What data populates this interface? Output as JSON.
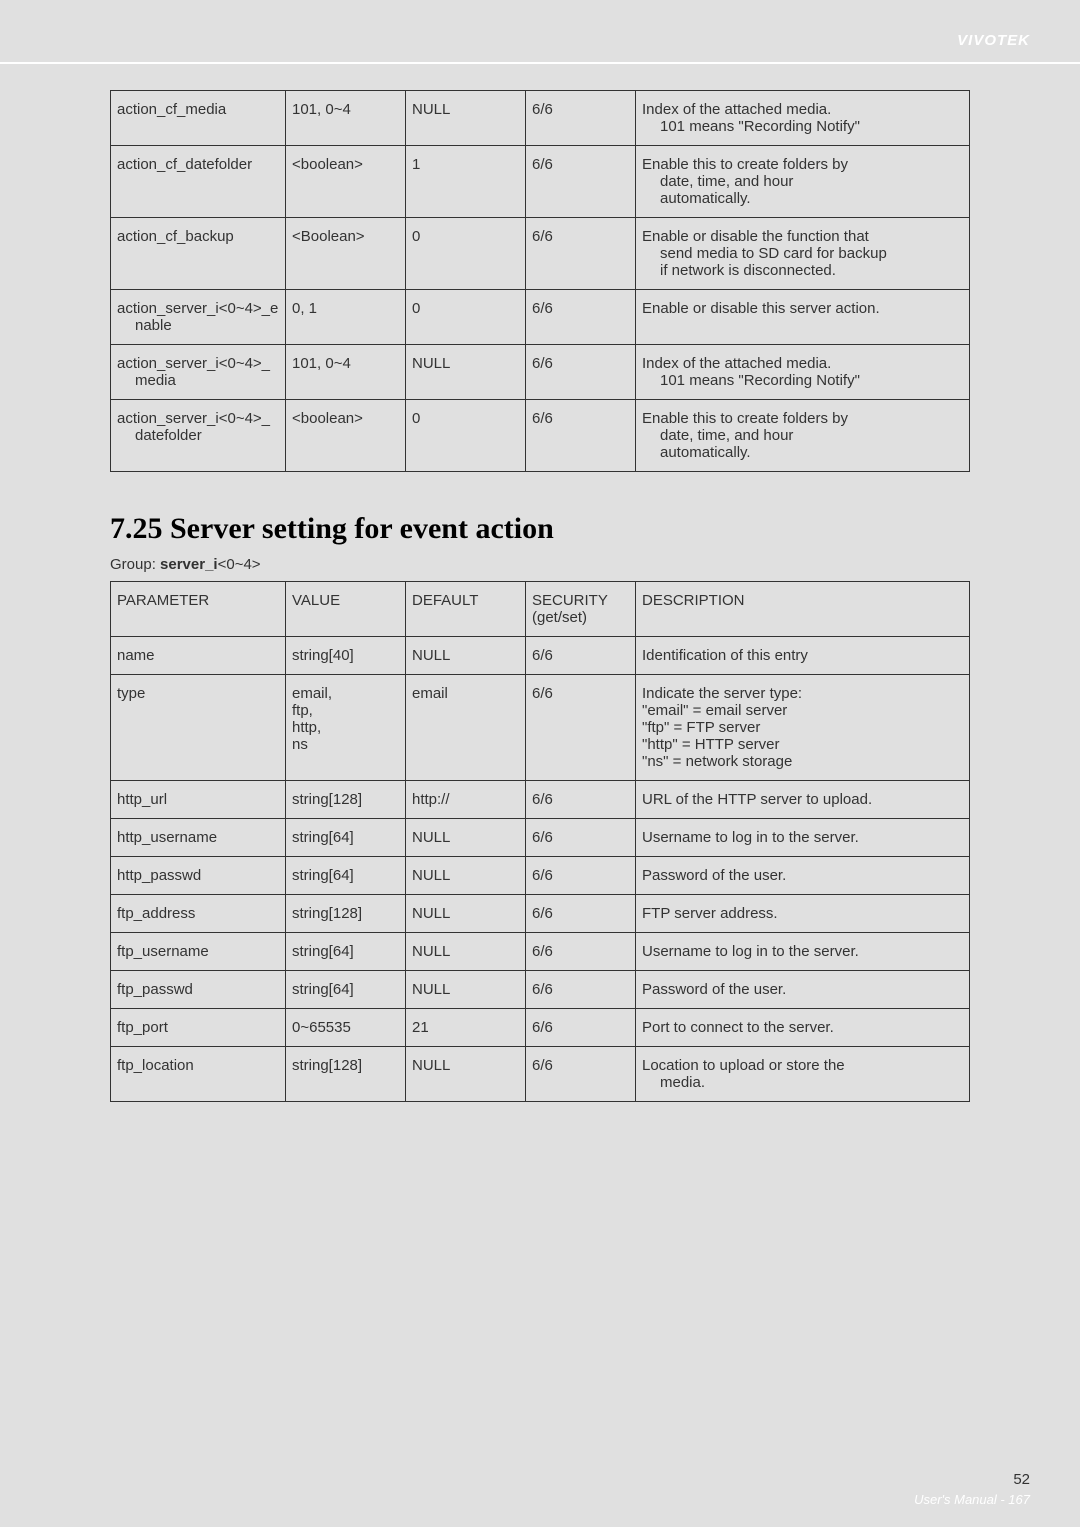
{
  "brand": "VIVOTEK",
  "table1": {
    "rows": [
      {
        "param": "action_cf_media",
        "value": "101, 0~4",
        "default": "NULL",
        "security": "6/6",
        "desc": "Index of the attached media.",
        "desc2": "101 means \"Recording Notify\""
      },
      {
        "param": "action_cf_datefolder",
        "value": "<boolean>",
        "default": "1",
        "security": "6/6",
        "desc": "Enable this to create folders by",
        "desc2": "date, time, and hour",
        "desc3": "automatically."
      },
      {
        "param": "action_cf_backup",
        "value": "<Boolean>",
        "default": "0",
        "security": "6/6",
        "desc": "Enable or disable the function that",
        "desc2": "send media to SD card for backup",
        "desc3": "if network is disconnected."
      },
      {
        "param": "action_server_i<0~4>_e",
        "param2": "nable",
        "value": "0, 1",
        "default": "0",
        "security": "6/6",
        "desc": "Enable or disable this server action."
      },
      {
        "param": "action_server_i<0~4>_",
        "param2": "media",
        "value": "101, 0~4",
        "default": "NULL",
        "security": "6/6",
        "desc": "Index of the attached media.",
        "desc2": "101 means \"Recording Notify\""
      },
      {
        "param": "action_server_i<0~4>_",
        "param2": "datefolder",
        "value": "<boolean>",
        "default": "0",
        "security": "6/6",
        "desc": "Enable this to create folders by",
        "desc2": "date, time, and hour",
        "desc3": "automatically."
      }
    ]
  },
  "section": {
    "title": "7.25 Server setting for event action",
    "group_prefix": "Group: ",
    "group_name": "server_i",
    "group_suffix": "<0~4>"
  },
  "table2": {
    "headers": {
      "param": "PARAMETER",
      "value": "VALUE",
      "default": "DEFAULT",
      "security": "SECURITY",
      "security2": "(get/set)",
      "desc": "DESCRIPTION"
    },
    "rows": [
      {
        "param": "name",
        "value": "string[40]",
        "default": "NULL",
        "security": "6/6",
        "desc": "Identification of this entry"
      },
      {
        "param": "type",
        "value": "email,",
        "value2": "ftp,",
        "value3": "http,",
        "value4": "ns",
        "default": "email",
        "security": "6/6",
        "desc": "Indicate the server type:",
        "desc2": "\"email\" = email server",
        "desc3": "\"ftp\" = FTP server",
        "desc4": "\"http\" = HTTP server",
        "desc5": "\"ns\" = network storage"
      },
      {
        "param": "http_url",
        "value": "string[128]",
        "default": "http://",
        "security": "6/6",
        "desc": "URL of the HTTP server to upload."
      },
      {
        "param": "http_username",
        "value": "string[64]",
        "default": "NULL",
        "security": "6/6",
        "desc": "Username to log in to the server."
      },
      {
        "param": "http_passwd",
        "value": "string[64]",
        "default": "NULL",
        "security": "6/6",
        "desc": "Password of the user."
      },
      {
        "param": "ftp_address",
        "value": "string[128]",
        "default": "NULL",
        "security": "6/6",
        "desc": "FTP server address."
      },
      {
        "param": "ftp_username",
        "value": "string[64]",
        "default": "NULL",
        "security": "6/6",
        "desc": "Username to log in to the server."
      },
      {
        "param": "ftp_passwd",
        "value": "string[64]",
        "default": "NULL",
        "security": "6/6",
        "desc": "Password of the user."
      },
      {
        "param": "ftp_port",
        "value": "0~65535",
        "default": "21",
        "security": "6/6",
        "desc": "Port to connect to the server."
      },
      {
        "param": "ftp_location",
        "value": "string[128]",
        "default": "NULL",
        "security": "6/6",
        "desc": "Location to upload or store the",
        "desc2": "media."
      }
    ]
  },
  "footer": {
    "page_inner": "52",
    "manual": "User's Manual - 167"
  }
}
